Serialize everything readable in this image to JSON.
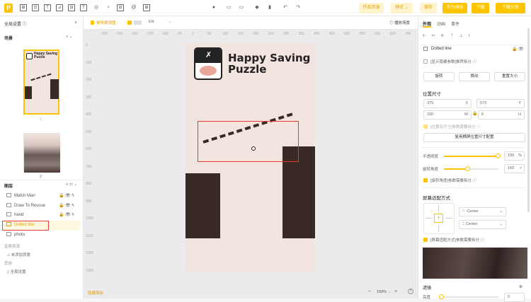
{
  "topbar": {
    "tools": [
      "P",
      "⊞",
      "⊡",
      "T",
      "⊿",
      "⊟",
      "T",
      "◎",
      "♀",
      "⊟",
      "@",
      "⊞"
    ],
    "center_icons": [
      "●",
      "▭",
      "▭",
      "◆",
      "▮",
      "↶",
      "↷"
    ],
    "buttons": {
      "works": "作品资源",
      "preview": "预览 ⌄",
      "save": "保存",
      "save_template": "存为模板",
      "download": "下载",
      "download_share": "下载分享"
    }
  },
  "left": {
    "global_settings": "全局设置 ⓘ",
    "scene_title": "场景",
    "scene_controls": "+ ⌄",
    "scene1_title_line1": "Happy Saving",
    "scene1_title_line2": "Puzzle",
    "scene1_number": "1",
    "scene2_number": "2",
    "layers_title": "图层",
    "layers": [
      {
        "name": "Match Man",
        "selected": false
      },
      {
        "name": "Draw To Rescue",
        "selected": false
      },
      {
        "name": "hand",
        "selected": false
      },
      {
        "name": "Dotted line",
        "selected": true
      },
      {
        "name": "photo",
        "selected": false
      }
    ],
    "audio_section": "音频资源",
    "audio_item": "未添加背景",
    "other_section": "其他",
    "other_item": "全局设置"
  },
  "center": {
    "ctool_label": "单场景视图",
    "ctool_lang": "EN",
    "ctool_right": "◎ 播放场景",
    "ruler_x": [
      "-300",
      "-250",
      "-200",
      "-150",
      "-100",
      "-50",
      "0",
      "50",
      "100",
      "150",
      "200",
      "250",
      "300",
      "350",
      "400",
      "450",
      "500",
      "550",
      "600",
      "650",
      "700",
      "750"
    ],
    "ruler_y": [
      "0",
      "100",
      "200",
      "300",
      "400",
      "500",
      "600",
      "700",
      "800",
      "900",
      "1000",
      "1100",
      "1200",
      "1300"
    ],
    "game_title_line1": "Happy Saving",
    "game_title_line2": "Puzzle",
    "bottom_left": "隐藏面板",
    "zoom_minus": "−",
    "zoom": "100%",
    "zoom_plus": "+",
    "help": "?"
  },
  "right": {
    "tabs": [
      "外观",
      "动画",
      "事件"
    ],
    "element_name": "Dotted line",
    "show_hidden": "[显示隐藏参数]推荐拆分 ⓘ",
    "action_buttons": [
      "旋转",
      "换动",
      "重置大小"
    ],
    "pos_size_title": "位置尺寸",
    "x_value": "375",
    "x_label": "X",
    "y_value": "573",
    "y_label": "Y",
    "w_value": "330",
    "w_label": "W",
    "h_value": "6",
    "h_label": "H",
    "pos_note": "[位置及尺寸]参数需要拆分 ⓘ",
    "apply_button": "复用横屏位置尺寸配置",
    "opacity_label": "不透明度",
    "opacity_value": "100",
    "opacity_unit": "%",
    "rotation_label": "旋转角度",
    "rotation_value": "160",
    "rotation_note": "[旋转角度]参数需要拆分 ⓘ",
    "screen_adapt_title": "屏幕适配方式",
    "h_align": "Center",
    "v_align": "Center",
    "adapt_note": "[屏幕适配方式]参数需要拆分 ⓘ",
    "bottom_title": "滤镜",
    "bottom_label": "亮度",
    "bottom_value": "0"
  },
  "accent": "#ffc400",
  "selection_red": "#e53935",
  "opacity_fraction": 1.0,
  "rotation_fraction": 0.44
}
